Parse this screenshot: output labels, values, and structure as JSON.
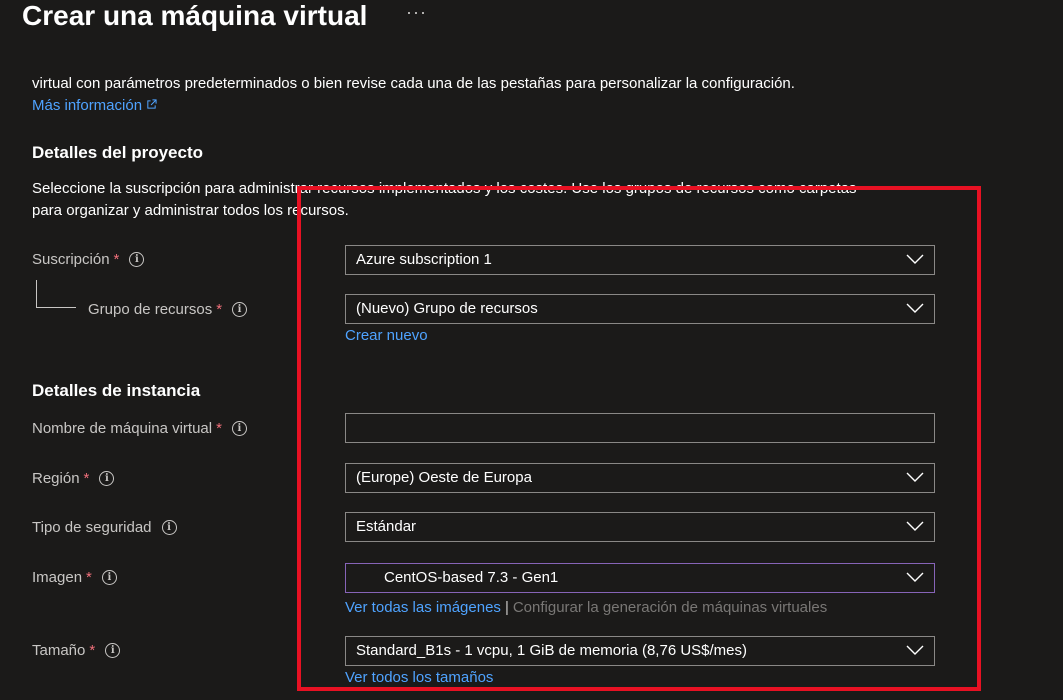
{
  "header": {
    "title": "Crear una máquina virtual",
    "more": "···"
  },
  "intro": {
    "line2": "virtual con parámetros predeterminados o bien revise cada una de las pestañas para personalizar la configuración.",
    "more_info": "Más información"
  },
  "project": {
    "heading": "Detalles del proyecto",
    "desc1": "Seleccione la suscripción para administrar recursos implementados y los costes. Use los grupos de recursos como carpetas",
    "desc2": "para organizar y administrar todos los recursos.",
    "subscription_label": "Suscripción",
    "subscription_value": "Azure subscription 1",
    "rg_label": "Grupo de recursos",
    "rg_value": "(Nuevo) Grupo de recursos",
    "create_new": "Crear nuevo"
  },
  "instance": {
    "heading": "Detalles de instancia",
    "vm_name_label": "Nombre de máquina virtual",
    "vm_name_value": "",
    "region_label": "Región",
    "region_value": "(Europe) Oeste de Europa",
    "security_label": "Tipo de seguridad",
    "security_value": "Estándar",
    "image_label": "Imagen",
    "image_value": "CentOS-based 7.3 - Gen1",
    "see_images": "Ver todas las imágenes",
    "separator": "|",
    "configure_gen": "Configurar la generación de máquinas virtuales",
    "size_label": "Tamaño",
    "size_value": "Standard_B1s - 1 vcpu, 1 GiB de memoria (8,76 US$/mes)",
    "see_sizes": "Ver todos los tamaños"
  },
  "marks": {
    "required": "*",
    "info": "i"
  },
  "colors": {
    "background": "#1b1a19",
    "link": "#4fa3ff",
    "required": "#f1707b",
    "highlight_box": "#e81123",
    "image_field_border": "#8764b8"
  }
}
